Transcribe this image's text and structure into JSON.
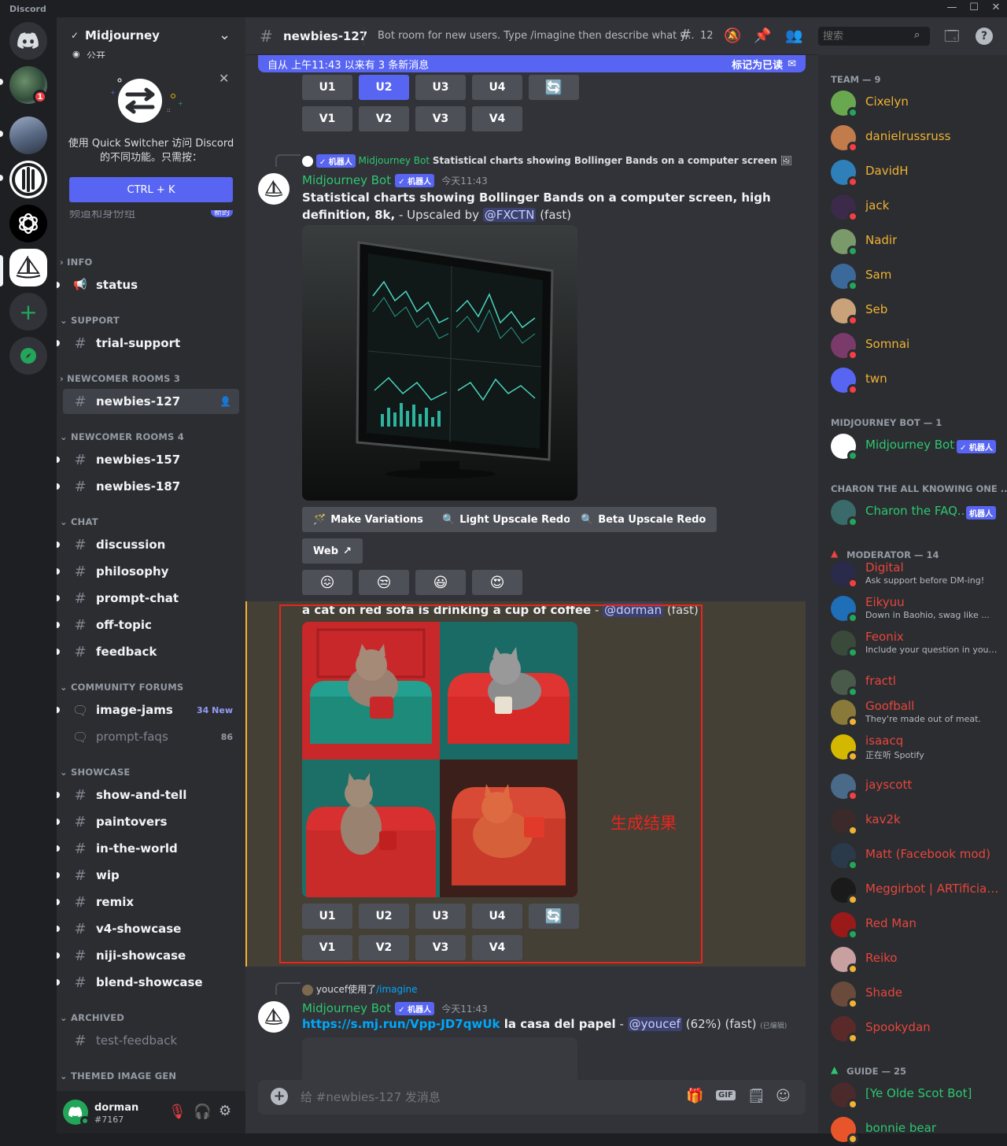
{
  "app": {
    "title": "Discord"
  },
  "servers": {
    "badge_count": "1"
  },
  "guild": {
    "name": "Midjourney",
    "visibility": "公开"
  },
  "quick_switcher": {
    "text_line1": "使用 Quick Switcher 访问 Discord",
    "text_line2": "的不同功能。只需按：",
    "shortcut": "CTRL + K"
  },
  "sidebar": {
    "hidden_row": "频道和身份组",
    "hidden_badge": "新的",
    "categories": {
      "info": "INFO",
      "support": "SUPPORT",
      "newcomer3": "NEWCOMER ROOMS 3",
      "newcomer4": "NEWCOMER ROOMS 4",
      "chat": "CHAT",
      "forums": "COMMUNITY FORUMS",
      "showcase": "SHOWCASE",
      "archived": "ARCHIVED",
      "themed": "THEMED IMAGE GEN"
    },
    "channels": {
      "status": "status",
      "trial_support": "trial-support",
      "newbies_127": "newbies-127",
      "newbies_157": "newbies-157",
      "newbies_187": "newbies-187",
      "discussion": "discussion",
      "philosophy": "philosophy",
      "prompt_chat": "prompt-chat",
      "off_topic": "off-topic",
      "feedback": "feedback",
      "image_jams": "image-jams",
      "image_jams_badge": "34 New",
      "prompt_faqs": "prompt-faqs",
      "prompt_faqs_count": "86",
      "show_and_tell": "show-and-tell",
      "paintovers": "paintovers",
      "in_the_world": "in-the-world",
      "wip": "wip",
      "remix": "remix",
      "v4_showcase": "v4-showcase",
      "niji_showcase": "niji-showcase",
      "blend_showcase": "blend-showcase",
      "test_feedback": "test-feedback"
    }
  },
  "user": {
    "name": "dorman",
    "tag": "#7167"
  },
  "header": {
    "channel": "newbies-127",
    "topic": "Bot room for new users. Type /imagine then describe what y...",
    "threads_count": "12",
    "search_placeholder": "搜索"
  },
  "banner": {
    "text": "自从 上午11:43 以来有 3 条新消息",
    "action": "标记为已读"
  },
  "buttons": {
    "u1": "U1",
    "u2": "U2",
    "u3": "U3",
    "u4": "U4",
    "v1": "V1",
    "v2": "V2",
    "v3": "V3",
    "v4": "V4",
    "make_variations": "Make Variations",
    "light_upscale": "Light Upscale Redo",
    "beta_upscale": "Beta Upscale Redo",
    "web": "Web"
  },
  "messages": {
    "m1": {
      "reply_tag": "✓ 机器人",
      "reply_author": "Midjourney Bot",
      "reply_text": "Statistical charts showing Bollinger Bands on a computer screen",
      "author": "Midjourney Bot",
      "bot_tag": "✓ 机器人",
      "time": "今天11:43",
      "prompt": "Statistical charts showing Bollinger Bands on a computer screen, high definition, 8k,",
      "suffix": " - Upscaled by ",
      "mention": "@FXCTN",
      "speed": " (fast)"
    },
    "m2": {
      "prompt": "a cat on red sofa is drinking a cup of coffee",
      "dash": " - ",
      "mention": "@dorman",
      "speed": " (fast)",
      "annotation": "生成结果"
    },
    "m3": {
      "reply_user": "youcef使用了",
      "reply_cmd": "/imagine",
      "author": "Midjourney Bot",
      "bot_tag": "✓ 机器人",
      "time": "今天11:43",
      "link": "https://s.mj.run/Vpp-JD7qwUk",
      "prompt": " la casa del papel",
      "dash": " - ",
      "mention": "@youcef",
      "progress": " (62%) (fast)",
      "edited": "(已编辑)"
    }
  },
  "composer": {
    "placeholder": "给 #newbies-127 发消息",
    "gif": "GIF"
  },
  "members": {
    "team": {
      "title": "TEAM — 9",
      "list": [
        {
          "name": "Cixelyn",
          "color": "#f0b232"
        },
        {
          "name": "danielrussruss",
          "color": "#f0b232"
        },
        {
          "name": "DavidH",
          "color": "#f0b232"
        },
        {
          "name": "jack",
          "color": "#f0b232"
        },
        {
          "name": "Nadir",
          "color": "#f0b232"
        },
        {
          "name": "Sam",
          "color": "#f0b232"
        },
        {
          "name": "Seb",
          "color": "#f0b232"
        },
        {
          "name": "Somnai",
          "color": "#f0b232"
        },
        {
          "name": "twn",
          "color": "#f0b232"
        }
      ]
    },
    "bot": {
      "title": "MIDJOURNEY BOT — 1",
      "name": "Midjourney Bot",
      "tag": "✓ 机器人"
    },
    "charon": {
      "title": "CHARON THE ALL KNOWING ONE ...",
      "name": "Charon the FAQ...",
      "tag": "机器人"
    },
    "moderator": {
      "title": "MODERATOR — 14",
      "list": [
        {
          "name": "Digital",
          "status": "Ask support before DM-ing!"
        },
        {
          "name": "Eikyuu",
          "status": "Down in Baohio, swag like ..."
        },
        {
          "name": "Feonix",
          "status": "Include your question in your ..."
        },
        {
          "name": "fractl",
          "status": ""
        },
        {
          "name": "Goofball",
          "status": "They're made out of meat."
        },
        {
          "name": "isaacq",
          "status": "正在听 Spotify"
        },
        {
          "name": "jayscott",
          "status": ""
        },
        {
          "name": "kav2k",
          "status": ""
        },
        {
          "name": "Matt (Facebook mod)",
          "status": ""
        },
        {
          "name": "Meggirbot | ARTificial...",
          "status": ""
        },
        {
          "name": "Red Man",
          "status": ""
        },
        {
          "name": "Reiko",
          "status": ""
        },
        {
          "name": "Shade",
          "status": ""
        },
        {
          "name": "Spookydan",
          "status": ""
        }
      ]
    },
    "guide": {
      "title": "GUIDE — 25",
      "list": [
        {
          "name": "[Ye Olde Scot Bot]"
        },
        {
          "name": "bonnie bear"
        }
      ]
    }
  },
  "colors": {
    "blurple": "#5865f2",
    "team": "#f0b232",
    "moderator": "#e8453c",
    "guide": "#2dc770",
    "online": "#23a55a",
    "dnd": "#f23f43",
    "idle": "#f0b232"
  }
}
